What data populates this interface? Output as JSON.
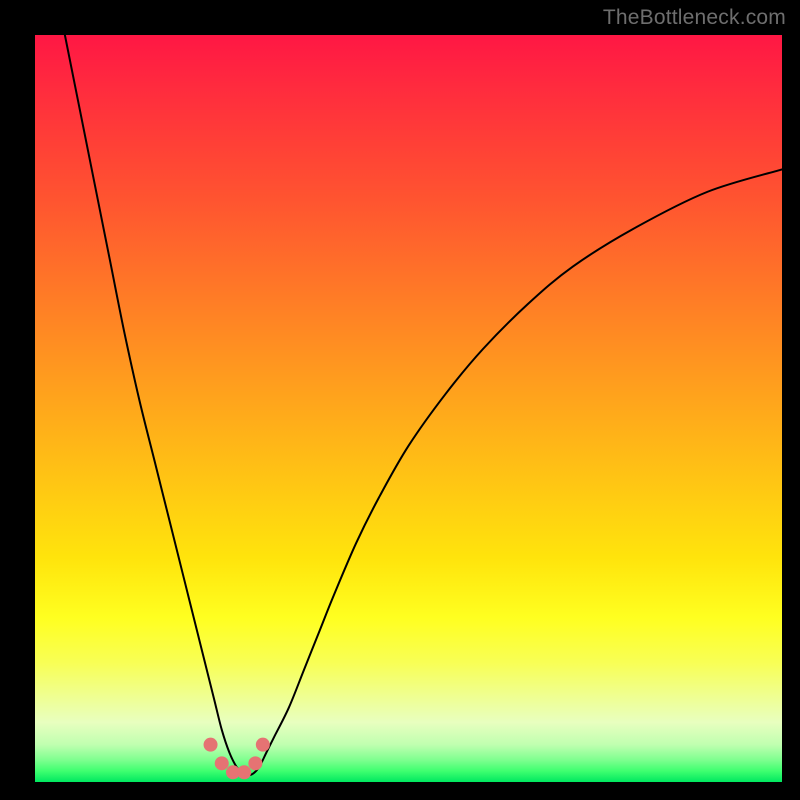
{
  "watermark": "TheBottleneck.com",
  "chart_data": {
    "type": "line",
    "title": "",
    "xlabel": "",
    "ylabel": "",
    "xlim": [
      0,
      100
    ],
    "ylim": [
      0,
      100
    ],
    "grid": false,
    "series": [
      {
        "name": "bottleneck-curve",
        "color": "#000000",
        "x": [
          4,
          6,
          8,
          10,
          12,
          14,
          16,
          18,
          20,
          22,
          23,
          24,
          25,
          26,
          27,
          28,
          29,
          30,
          31,
          32,
          34,
          36,
          38,
          40,
          43,
          46,
          50,
          55,
          60,
          66,
          72,
          80,
          90,
          100
        ],
        "values": [
          100,
          90,
          80,
          70,
          60,
          51,
          43,
          35,
          27,
          19,
          15,
          11,
          7,
          4,
          2,
          1,
          1,
          2,
          4,
          6,
          10,
          15,
          20,
          25,
          32,
          38,
          45,
          52,
          58,
          64,
          69,
          74,
          79,
          82
        ]
      }
    ],
    "markers": [
      {
        "x": 23.5,
        "y": 5.0,
        "color": "#e57373",
        "r": 7
      },
      {
        "x": 25.0,
        "y": 2.5,
        "color": "#e57373",
        "r": 7
      },
      {
        "x": 26.5,
        "y": 1.3,
        "color": "#e57373",
        "r": 7
      },
      {
        "x": 28.0,
        "y": 1.3,
        "color": "#e57373",
        "r": 7
      },
      {
        "x": 29.5,
        "y": 2.5,
        "color": "#e57373",
        "r": 7
      },
      {
        "x": 30.5,
        "y": 5.0,
        "color": "#e57373",
        "r": 7
      }
    ]
  }
}
